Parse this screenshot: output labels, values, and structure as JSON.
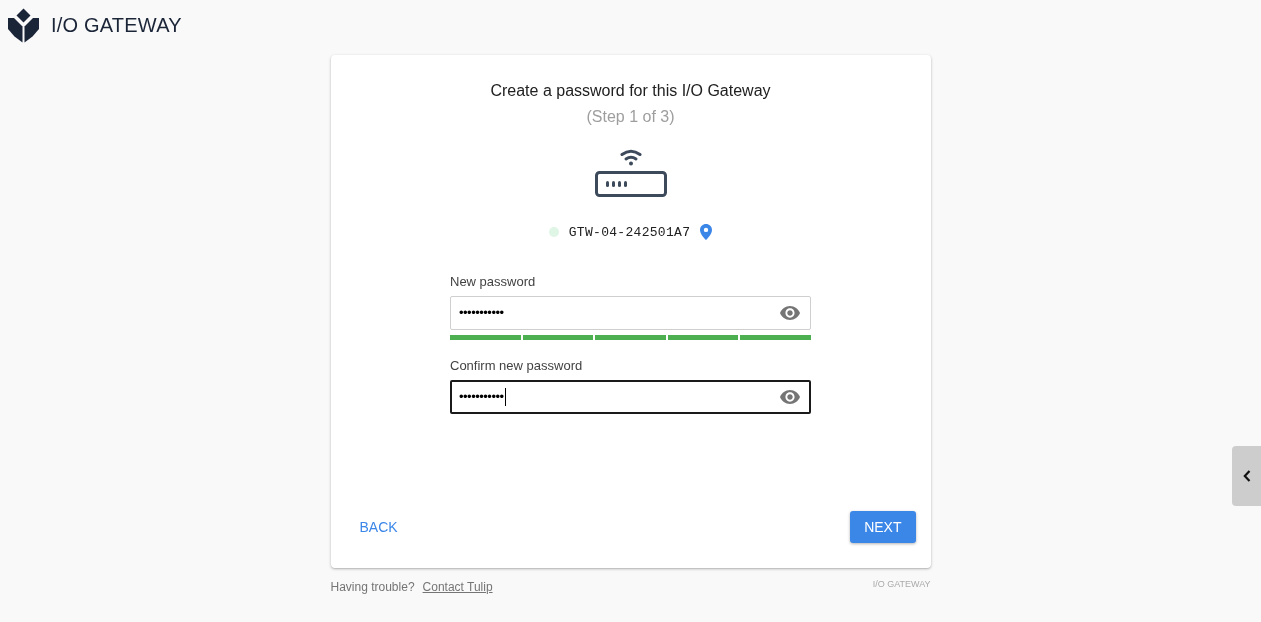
{
  "header": {
    "title": "I/O GATEWAY"
  },
  "card": {
    "title": "Create a password for this I/O Gateway",
    "subtitle": "(Step 1 of 3)",
    "device": {
      "id": "GTW-04-242501A7"
    },
    "fields": [
      {
        "label": "New password",
        "value": "•••••••••••",
        "focused": false,
        "strength_segments": [
          {
            "filled": true
          },
          {
            "filled": true
          },
          {
            "filled": true
          },
          {
            "filled": true
          },
          {
            "filled": true
          }
        ]
      },
      {
        "label": "Confirm new password",
        "value": "•••••••••••",
        "focused": true
      }
    ],
    "buttons": [
      {
        "label": "BACK",
        "kind": "text"
      },
      {
        "label": "NEXT",
        "kind": "primary"
      }
    ]
  },
  "footer": {
    "help_text": "Having trouble?",
    "link": "Contact Tulip",
    "brand": "I/O GATEWAY"
  }
}
